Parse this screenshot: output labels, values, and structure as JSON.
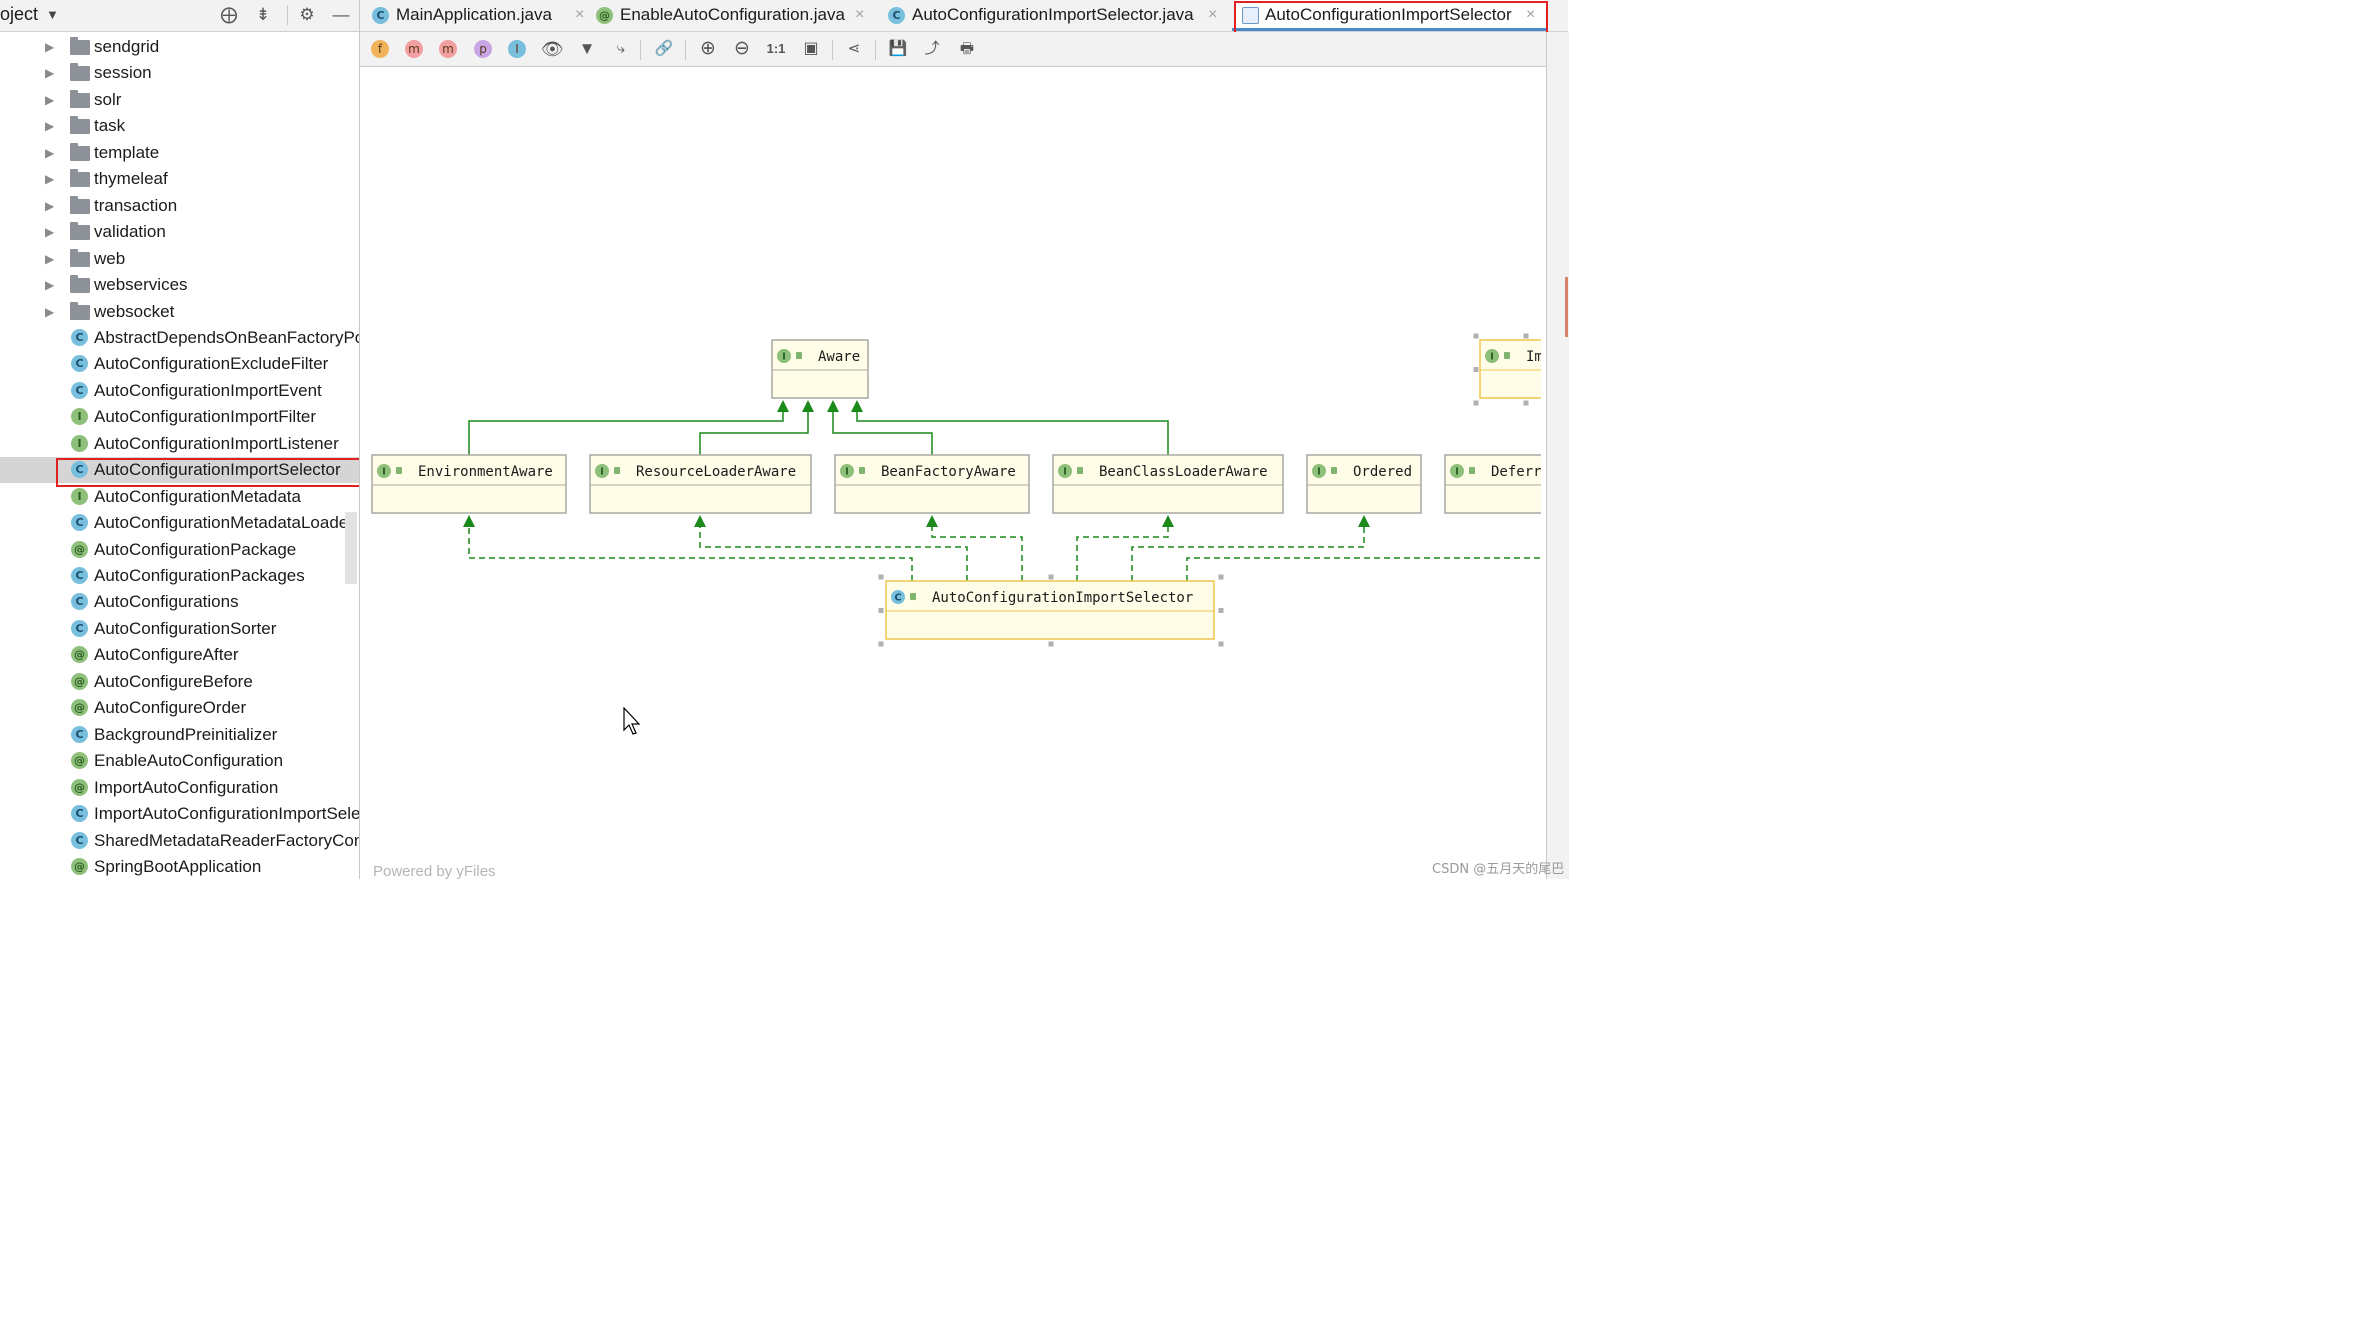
{
  "project_panel": {
    "title": "oject",
    "tree": [
      {
        "kind": "folder",
        "label": "sendgrid"
      },
      {
        "kind": "folder",
        "label": "session"
      },
      {
        "kind": "folder",
        "label": "solr"
      },
      {
        "kind": "folder",
        "label": "task"
      },
      {
        "kind": "folder",
        "label": "template"
      },
      {
        "kind": "folder",
        "label": "thymeleaf"
      },
      {
        "kind": "folder",
        "label": "transaction"
      },
      {
        "kind": "folder",
        "label": "validation"
      },
      {
        "kind": "folder",
        "label": "web"
      },
      {
        "kind": "folder",
        "label": "webservices"
      },
      {
        "kind": "folder",
        "label": "websocket"
      },
      {
        "kind": "abstract-class",
        "badge": "C",
        "label": "AbstractDependsOnBeanFactoryPostProcessor"
      },
      {
        "kind": "class",
        "badge": "C",
        "label": "AutoConfigurationExcludeFilter"
      },
      {
        "kind": "class",
        "badge": "C",
        "label": "AutoConfigurationImportEvent"
      },
      {
        "kind": "interface",
        "badge": "I",
        "label": "AutoConfigurationImportFilter"
      },
      {
        "kind": "interface",
        "badge": "I",
        "label": "AutoConfigurationImportListener"
      },
      {
        "kind": "class",
        "badge": "C",
        "label": "AutoConfigurationImportSelector",
        "selected": true
      },
      {
        "kind": "interface",
        "badge": "I",
        "label": "AutoConfigurationMetadata"
      },
      {
        "kind": "abstract-class",
        "badge": "C",
        "label": "AutoConfigurationMetadataLoader"
      },
      {
        "kind": "annotation",
        "badge": "@",
        "label": "AutoConfigurationPackage"
      },
      {
        "kind": "abstract-class",
        "badge": "C",
        "label": "AutoConfigurationPackages"
      },
      {
        "kind": "class",
        "badge": "C",
        "label": "AutoConfigurations"
      },
      {
        "kind": "class",
        "badge": "C",
        "label": "AutoConfigurationSorter"
      },
      {
        "kind": "annotation",
        "badge": "@",
        "label": "AutoConfigureAfter"
      },
      {
        "kind": "annotation",
        "badge": "@",
        "label": "AutoConfigureBefore"
      },
      {
        "kind": "annotation",
        "badge": "@",
        "label": "AutoConfigureOrder"
      },
      {
        "kind": "class",
        "badge": "C",
        "label": "BackgroundPreinitializer"
      },
      {
        "kind": "annotation",
        "badge": "@",
        "label": "EnableAutoConfiguration"
      },
      {
        "kind": "annotation",
        "badge": "@",
        "label": "ImportAutoConfiguration"
      },
      {
        "kind": "class",
        "badge": "C",
        "label": "ImportAutoConfigurationImportSelector"
      },
      {
        "kind": "class",
        "badge": "C",
        "label": "SharedMetadataReaderFactoryContextInitializer"
      },
      {
        "kind": "annotation",
        "badge": "@",
        "label": "SpringBootApplication"
      }
    ],
    "toolbar_icons": [
      "locate-icon",
      "collapse-all-icon",
      "gear-icon",
      "hide-icon"
    ]
  },
  "tabs": [
    {
      "label": "MainApplication.java",
      "icon": "C",
      "active": false
    },
    {
      "label": "EnableAutoConfiguration.java",
      "icon": "@",
      "active": false
    },
    {
      "label": "AutoConfigurationImportSelector.java",
      "icon": "C",
      "active": false
    },
    {
      "label": "AutoConfigurationImportSelector",
      "icon": "diagram",
      "active": true
    }
  ],
  "close_glyph": "×",
  "diagram_toolbar": {
    "filter_badges": [
      {
        "name": "fields-filter",
        "glyph": "f",
        "color": "#f0b35a"
      },
      {
        "name": "constructors-filter",
        "glyph": "m",
        "color": "#f19fa0"
      },
      {
        "name": "methods-filter",
        "glyph": "m",
        "color": "#f19fa0"
      },
      {
        "name": "properties-filter",
        "glyph": "p",
        "color": "#c8a6e6"
      },
      {
        "name": "inner-classes-filter",
        "glyph": "I",
        "color": "#78bedd"
      }
    ],
    "actual_size_label": "1:1"
  },
  "diagram": {
    "nodes": [
      {
        "id": "aware",
        "label": "Aware",
        "badge": "I",
        "kind": "interface"
      },
      {
        "id": "env",
        "label": "EnvironmentAware",
        "badge": "I",
        "kind": "interface"
      },
      {
        "id": "res",
        "label": "ResourceLoaderAware",
        "badge": "I",
        "kind": "interface"
      },
      {
        "id": "bf",
        "label": "BeanFactoryAware",
        "badge": "I",
        "kind": "interface"
      },
      {
        "id": "bcl",
        "label": "BeanClassLoaderAware",
        "badge": "I",
        "kind": "interface"
      },
      {
        "id": "ord",
        "label": "Ordered",
        "badge": "I",
        "kind": "interface"
      },
      {
        "id": "defer",
        "label": "Deferr",
        "badge": "I",
        "kind": "interface"
      },
      {
        "id": "imp",
        "label": "Im",
        "badge": "I",
        "kind": "interface"
      },
      {
        "id": "sel",
        "label": "AutoConfigurationImportSelector",
        "badge": "C",
        "kind": "class"
      }
    ],
    "extends": [
      "env",
      "res",
      "bf",
      "bcl"
    ],
    "implements": [
      "env",
      "res",
      "bf",
      "bcl",
      "ord",
      "defer"
    ],
    "colors": {
      "edge": "#1a8a1a",
      "node_fill": "#fffde8",
      "node_border": "#a9a9a0",
      "selected_border": "#f0c54a"
    }
  },
  "powered_by": "Powered by yFiles",
  "watermark": "CSDN @五月天的尾巴"
}
